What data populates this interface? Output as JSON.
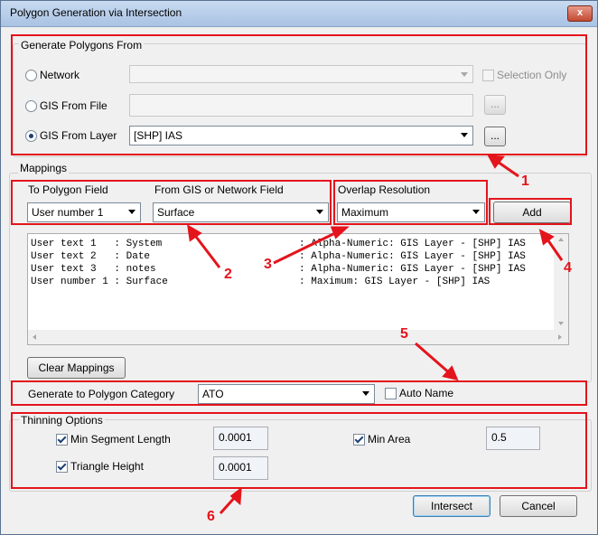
{
  "window": {
    "title": "Polygon Generation via Intersection",
    "close_symbol": "x"
  },
  "generate_from": {
    "label": "Generate Polygons From",
    "network": {
      "label": "Network",
      "selected": false
    },
    "selection_only_label": "Selection Only",
    "gis_file": {
      "label": "GIS From File",
      "browse_label": "..."
    },
    "gis_layer": {
      "label": "GIS From Layer",
      "selected": true,
      "value": "[SHP] IAS",
      "browse_label": "..."
    }
  },
  "mappings": {
    "label": "Mappings",
    "to_polygon_field": {
      "label": "To Polygon Field",
      "value": "User number 1"
    },
    "from_field": {
      "label": "From GIS or Network Field",
      "value": "Surface"
    },
    "overlap": {
      "label": "Overlap Resolution",
      "value": "Maximum"
    },
    "add_label": "Add",
    "rows": [
      "User text 1   : System                       : Alpha-Numeric: GIS Layer - [SHP] IAS",
      "User text 2   : Date                         : Alpha-Numeric: GIS Layer - [SHP] IAS",
      "User text 3   : notes                        : Alpha-Numeric: GIS Layer - [SHP] IAS",
      "User number 1 : Surface                      : Maximum: GIS Layer - [SHP] IAS"
    ],
    "clear_label": "Clear Mappings"
  },
  "category": {
    "label": "Generate to Polygon Category",
    "value": "ATO",
    "auto_name_label": "Auto Name",
    "auto_name_checked": false
  },
  "thinning": {
    "label": "Thinning Options",
    "min_segment": {
      "label": "Min Segment Length",
      "checked": true,
      "value": "0.0001"
    },
    "min_area": {
      "label": "Min Area",
      "checked": true,
      "value": "0.5"
    },
    "triangle_height": {
      "label": "Triangle Height",
      "checked": true,
      "value": "0.0001"
    }
  },
  "buttons": {
    "intersect": "Intersect",
    "cancel": "Cancel"
  },
  "annotations": {
    "callouts": [
      "1",
      "2",
      "3",
      "4",
      "5",
      "6"
    ],
    "color": "#e4141c"
  }
}
